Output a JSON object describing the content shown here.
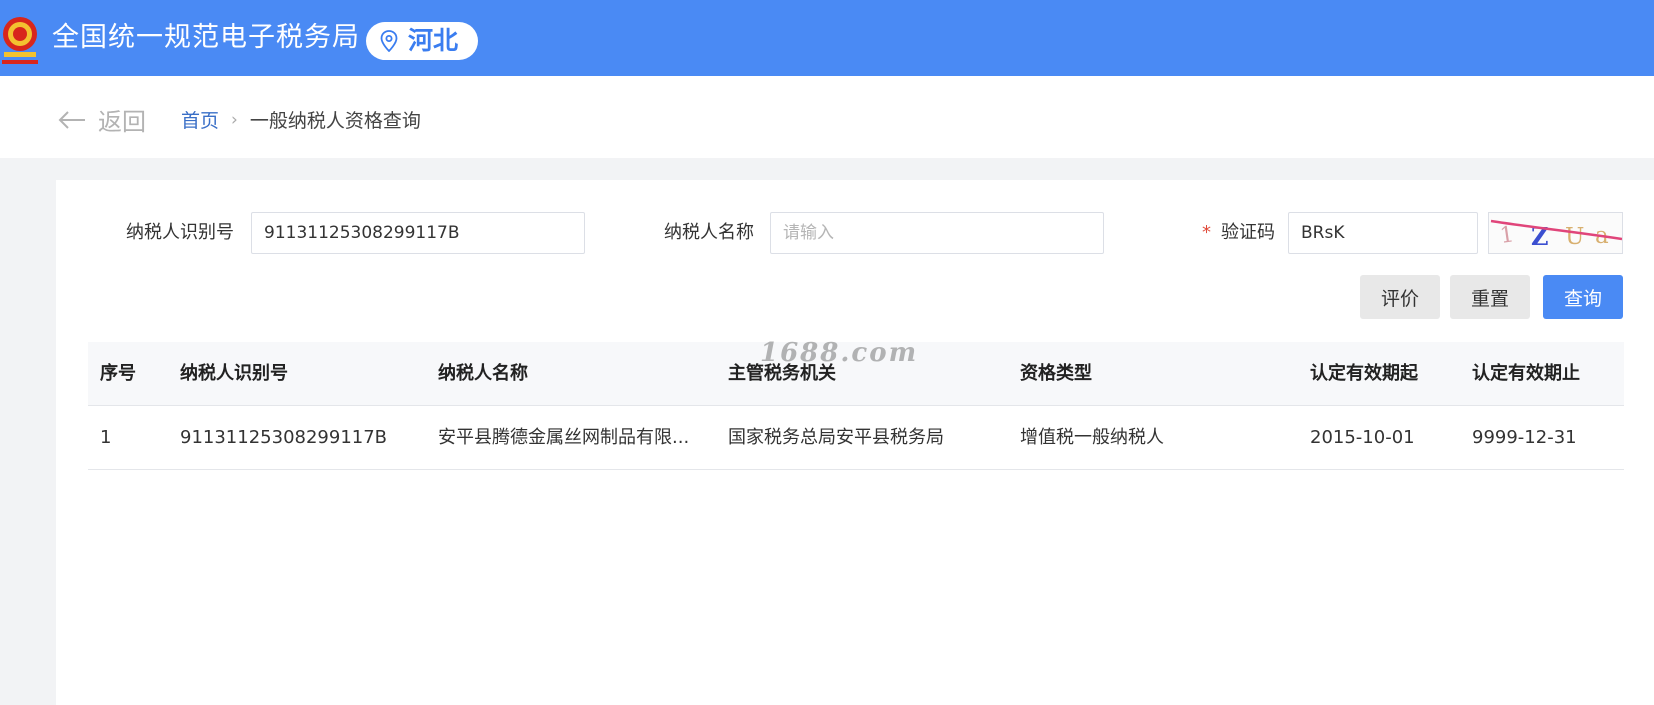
{
  "header": {
    "title": "全国统一规范电子税务局",
    "region": "河北",
    "emblem_icon": "national-emblem-icon",
    "pin_icon": "location-pin-icon"
  },
  "nav": {
    "back_label": "返回",
    "breadcrumb": {
      "home": "首页",
      "separator": "›",
      "current": "一般纳税人资格查询"
    }
  },
  "form": {
    "taxpayer_id": {
      "label": "纳税人识别号",
      "value": "91131125308299117B"
    },
    "taxpayer_name": {
      "label": "纳税人名称",
      "placeholder": "请输入"
    },
    "captcha": {
      "required_mark": "*",
      "label": "验证码",
      "value": "BRsK",
      "image_text": "1 Z U a"
    }
  },
  "buttons": {
    "evaluate": "评价",
    "reset": "重置",
    "query": "查询"
  },
  "table": {
    "columns": [
      "序号",
      "纳税人识别号",
      "纳税人名称",
      "主管税务机关",
      "资格类型",
      "认定有效期起",
      "认定有效期止"
    ],
    "rows": [
      [
        "1",
        "91131125308299117B",
        "安平县腾德金属丝网制品有限...",
        "国家税务总局安平县税务局",
        "增值税一般纳税人",
        "2015-10-01",
        "9999-12-31"
      ]
    ]
  },
  "watermark": "1688.com",
  "colors": {
    "primary": "#4a8af4",
    "link": "#3a6fc7",
    "required": "#e04a3a"
  }
}
